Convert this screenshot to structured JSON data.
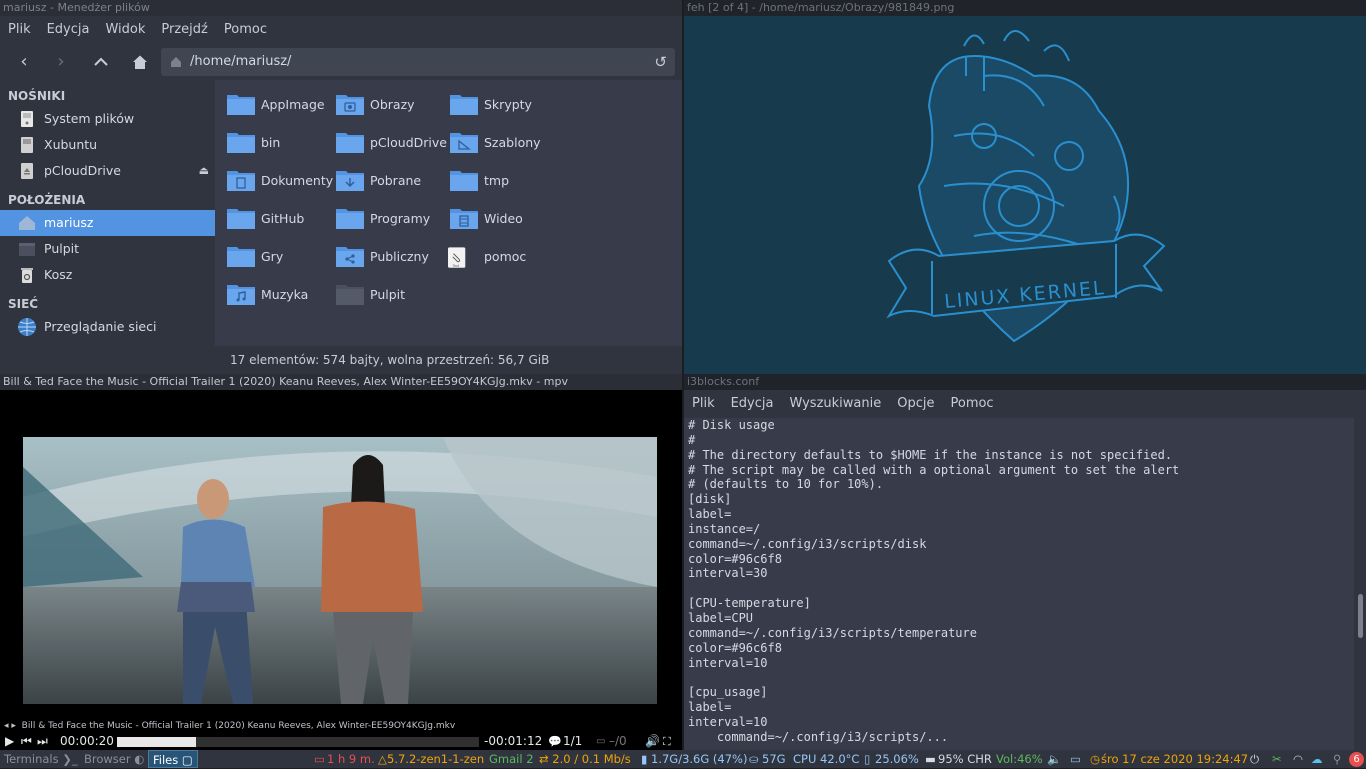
{
  "file_manager": {
    "title": "mariusz - Menedżer plików",
    "menu": [
      "Plik",
      "Edycja",
      "Widok",
      "Przejdź",
      "Pomoc"
    ],
    "path": "/home/mariusz/",
    "sidebar": {
      "devices_heading": "NOŚNIKI",
      "devices": [
        "System plików",
        "Xubuntu",
        "pCloudDrive"
      ],
      "places_heading": "POŁOŻENIA",
      "places": [
        "mariusz",
        "Pulpit",
        "Kosz"
      ],
      "network_heading": "SIEĆ",
      "network": [
        "Przeglądanie sieci"
      ]
    },
    "files": [
      "AppImage",
      "Obrazy",
      "Skrypty",
      "bin",
      "pCloudDrive",
      "Szablony",
      "Dokumenty",
      "Pobrane",
      "tmp",
      "GitHub",
      "Programy",
      "Wideo",
      "Gry",
      "Publiczny",
      "pomoc",
      "Muzyka",
      "Pulpit"
    ],
    "file_badge": "Text",
    "status": "17 elementów: 574 bajty, wolna przestrzeń: 56,7 GiB"
  },
  "feh": {
    "title": "feh [2 of 4] - /home/mariusz/Obrazy/981849.png",
    "banner_text": "LINUX KERNEL"
  },
  "mpv": {
    "title": "Bill & Ted Face the Music - Official Trailer 1 (2020) Keanu Reeves, Alex Winter-EE59OY4KGJg.mkv - mpv",
    "osd_title": "Bill & Ted Face the Music - Official Trailer 1 (2020) Keanu Reeves, Alex Winter-EE59OY4KGJg.mkv",
    "elapsed": "00:00:20",
    "remaining": "-00:01:12",
    "progress_fraction": 0.218,
    "subs": "1/1",
    "audio": "–/0"
  },
  "editor": {
    "title": "i3blocks.conf",
    "menu": [
      "Plik",
      "Edycja",
      "Wyszukiwanie",
      "Opcje",
      "Pomoc"
    ],
    "content": "# Disk usage\n#\n# The directory defaults to $HOME if the instance is not specified.\n# The script may be called with a optional argument to set the alert\n# (defaults to 10 for 10%).\n[disk]\nlabel=\ninstance=/\ncommand=~/.config/i3/scripts/disk\ncolor=#96c6f8\ninterval=30\n\n[CPU-temperature]\nlabel=CPU\ncommand=~/.config/i3/scripts/temperature\ncolor=#96c6f8\ninterval=10\n\n[cpu_usage]\nlabel=\ninterval=10\n    command=~/.config/i3/scripts/..."
  },
  "bar": {
    "workspaces": [
      "Terminals ❯_",
      "Browser ◐",
      "Files ▢"
    ],
    "uptime": "1 h 9 m.",
    "kernel": "5.7.2-zen1-1-zen",
    "gmail": "Gmail 2",
    "net": "⇄ 2.0  /  0.1 Mb/s",
    "mem": "1.7G/3.6G (47%)",
    "disk": "57G",
    "cpu_temp": "CPU 42.0°C",
    "cpu_usage": "25.06%",
    "battery": "95% CHR",
    "volume": "Vol:46%",
    "datetime": "śro 17 cze 2020 19:24:47",
    "notif_count": "6",
    "colors": {
      "accent": "#5294e2",
      "orange": "#f0a30a",
      "green": "#5fb85f",
      "blue": "#96c6f8"
    }
  }
}
